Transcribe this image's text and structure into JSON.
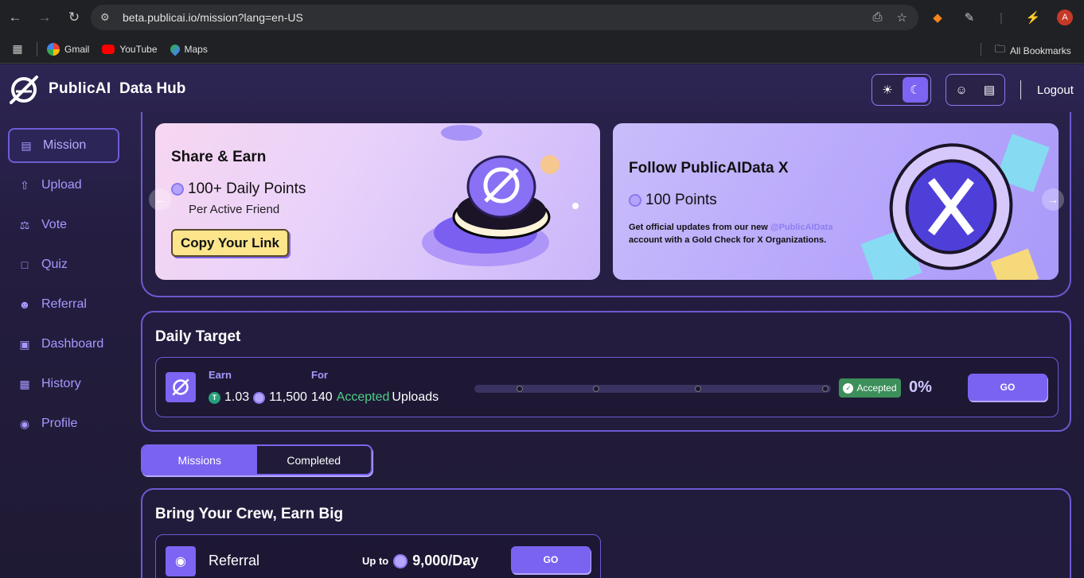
{
  "browser": {
    "url": "beta.publicai.io/mission?lang=en-US",
    "avatar_letter": "A",
    "bookmarks": [
      {
        "label": "Gmail"
      },
      {
        "label": "YouTube"
      },
      {
        "label": "Maps"
      }
    ],
    "all_bookmarks": "All Bookmarks"
  },
  "header": {
    "brand": "PublicAI",
    "product": "Data Hub",
    "logout": "Logout"
  },
  "sidebar": {
    "items": [
      {
        "label": "Mission",
        "icon": "clipboard-icon"
      },
      {
        "label": "Upload",
        "icon": "upload-icon"
      },
      {
        "label": "Vote",
        "icon": "vote-icon"
      },
      {
        "label": "Quiz",
        "icon": "quiz-icon"
      },
      {
        "label": "Referral",
        "icon": "referral-icon"
      },
      {
        "label": "Dashboard",
        "icon": "dashboard-icon"
      },
      {
        "label": "History",
        "icon": "history-icon"
      },
      {
        "label": "Profile",
        "icon": "profile-icon"
      }
    ]
  },
  "banner": {
    "card1": {
      "title": "Share & Earn",
      "points": "100+ Daily Points",
      "sub": "Per Active Friend",
      "button": "Copy Your Link"
    },
    "card2": {
      "title": "Follow PublicAIData X",
      "points": "100 Points",
      "desc_prefix": "Get official updates from our new ",
      "desc_handle": "@PublicAIData",
      "desc_suffix": "account with a Gold Check for X Organizations."
    }
  },
  "daily_target": {
    "title": "Daily Target",
    "earn_label": "Earn",
    "for_label": "For",
    "earn_usdt": "1.03",
    "earn_points": "11,500",
    "for_count": "140",
    "for_accepted": "Accepted",
    "for_uploads": "Uploads",
    "badge": "Accepted",
    "progress_percent_text": "0%",
    "progress_value": 0,
    "go": "GO"
  },
  "tabs": {
    "missions": "Missions",
    "completed": "Completed"
  },
  "crew": {
    "title": "Bring Your Crew, Earn Big",
    "referral_label": "Referral",
    "up_to": "Up to",
    "amount": "9,000/Day",
    "go": "GO"
  },
  "colors": {
    "accent": "#7b63f1",
    "accepted_green": "#4fcf86"
  }
}
